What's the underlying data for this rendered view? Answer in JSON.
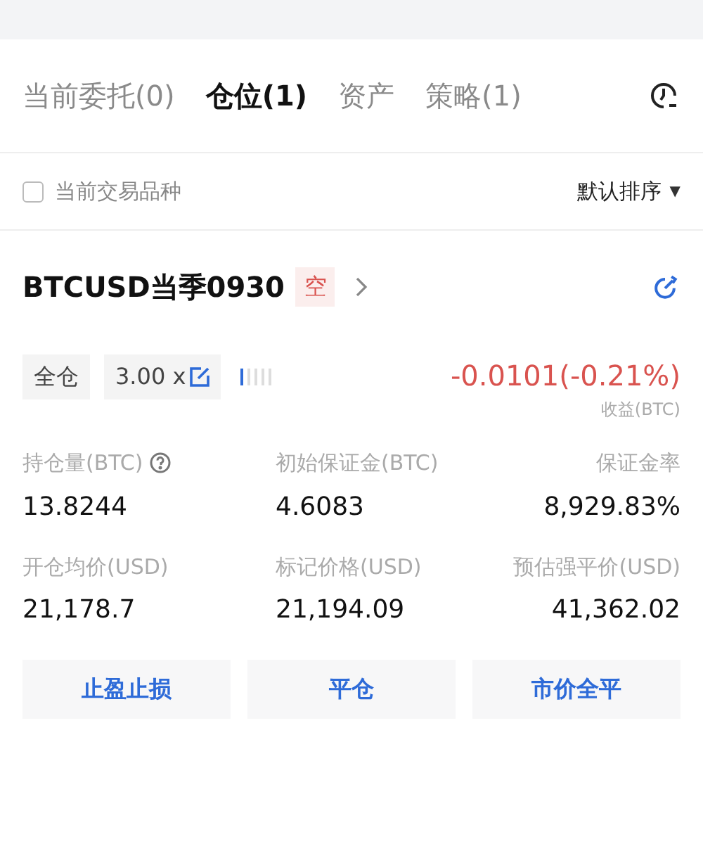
{
  "tabs": [
    {
      "label": "当前委托(0)",
      "selected": false
    },
    {
      "label": "仓位(1)",
      "selected": true
    },
    {
      "label": "资产",
      "selected": false
    },
    {
      "label": "策略(1)",
      "selected": false
    }
  ],
  "filter": {
    "label": "当前交易品种",
    "checked": false,
    "sort": "默认排序",
    "sort_arrow": "▼"
  },
  "position": {
    "symbol": "BTCUSD当季0930",
    "side": "空",
    "margin_mode": "全仓",
    "leverage": "3.00 x",
    "risk": {
      "level": 0.2
    },
    "pnl": "-0.0101(-0.21%)",
    "pnl_label": "收益(BTC)",
    "stats": [
      {
        "label": "持仓量(BTC)",
        "value": "13.8244",
        "help": true
      },
      {
        "label": "初始保证金(BTC)",
        "value": "4.6083",
        "help": false
      },
      {
        "label": "保证金率",
        "value": "8,929.83%",
        "help": false
      },
      {
        "label": "开仓均价(USD)",
        "value": "21,178.7",
        "help": false
      },
      {
        "label": "标记价格(USD)",
        "value": "21,194.09",
        "help": false
      },
      {
        "label": "预估强平价(USD)",
        "value": "41,362.02",
        "help": false
      }
    ],
    "actions": [
      "止盈止损",
      "平仓",
      "市价全平"
    ]
  }
}
